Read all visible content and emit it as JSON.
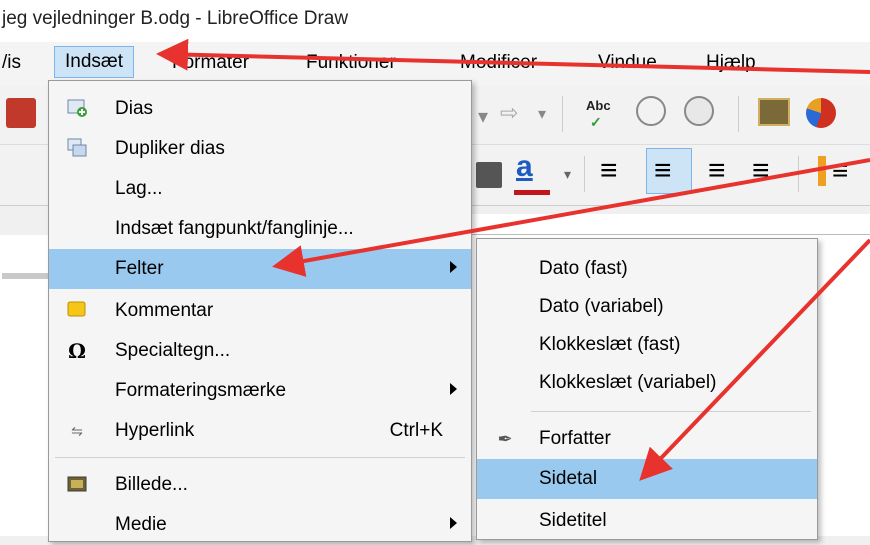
{
  "window": {
    "title": "jeg vejledninger B.odg - LibreOffice Draw"
  },
  "menubar": {
    "items": [
      {
        "label": "/is"
      },
      {
        "label": "Indsæt"
      },
      {
        "label": "Formater"
      },
      {
        "label": "Funktioner"
      },
      {
        "label": "Modificer"
      },
      {
        "label": "Vindue"
      },
      {
        "label": "Hjælp"
      }
    ]
  },
  "insert_menu": {
    "items": [
      {
        "label": "Dias",
        "icon": "new-slide-icon"
      },
      {
        "label": "Dupliker dias",
        "icon": "duplicate-slide-icon"
      },
      {
        "label": "Lag...",
        "icon": ""
      },
      {
        "label": "Indsæt fangpunkt/fanglinje...",
        "icon": ""
      },
      {
        "label": "Felter",
        "icon": ""
      },
      {
        "label": "Kommentar",
        "icon": "comment-icon"
      },
      {
        "label": "Specialtegn...",
        "icon": "omega-icon"
      },
      {
        "label": "Formateringsmærke",
        "icon": ""
      },
      {
        "label": "Hyperlink",
        "icon": "hyperlink-icon",
        "shortcut": "Ctrl+K"
      },
      {
        "label": "Billede...",
        "icon": "image-icon"
      },
      {
        "label": "Medie",
        "icon": ""
      }
    ]
  },
  "fields_submenu": {
    "items": [
      {
        "label": "Dato (fast)"
      },
      {
        "label": "Dato (variabel)"
      },
      {
        "label": "Klokkeslæt (fast)"
      },
      {
        "label": "Klokkeslæt (variabel)"
      },
      {
        "label": "Forfatter"
      },
      {
        "label": "Sidetal"
      },
      {
        "label": "Sidetitel"
      }
    ]
  },
  "toolbar": {
    "spellcheck_label": "Abc"
  },
  "colors": {
    "menu_highlight": "#99c9ef",
    "arrow": "#e8322d"
  }
}
